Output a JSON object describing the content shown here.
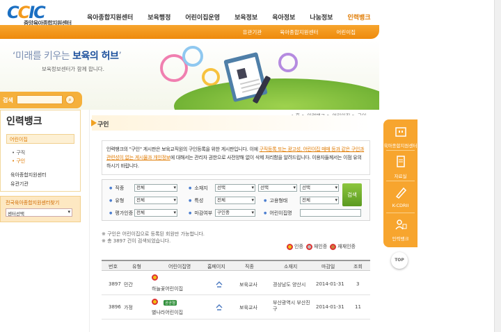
{
  "header": {
    "logo_text": "CCIC",
    "logo_name": "중앙육아종합지원센터",
    "nav": [
      "육아종합지원센터",
      "보육행정",
      "어린이집운영",
      "보육정보",
      "육아정보",
      "나눔정보",
      "인력뱅크"
    ],
    "active_nav": "인력뱅크",
    "subnav": [
      "유관기관",
      "육아종합지원센터",
      "어린이집"
    ]
  },
  "banner": {
    "slogan_pre": "‘미래를 키우는 ",
    "slogan_bold": "보육의 허브",
    "slogan_post": "’",
    "sub": "보육정보센터가 함께 합니다."
  },
  "sidebar": {
    "search_label": "검색",
    "search_value": "",
    "search_icon": "magnifier-icon",
    "title": "인력뱅크",
    "section": "어린이집",
    "sub_items": [
      "• 구직",
      "• 구인"
    ],
    "active_sub": "• 구인",
    "links": [
      "육아종합지원센터",
      "유관기관"
    ],
    "center_finder_label": "전국육아종합지원센터찾기",
    "center_select": "센터선택"
  },
  "content": {
    "breadcrumb": "⌂ 홈 > 인력뱅크 > 어린이집 > 구인",
    "title": "구인",
    "notice_1": "인력뱅크의 \"구인\" 게시판은 보육교직원의 구인등록을 위한 게시판입니다. 이에 ",
    "notice_u": "구직등록 또는 광고성, 어린이집 매매 등과 같은 구인과 관련성이 없는 게시물과 개인정보",
    "notice_2": "에 대해서는 관리자 권한으로 사전양해 없이 삭제 처리함을 알려드립니다. 이용자들께서는 이점 유의하시기 바랍니다.",
    "form": {
      "job_label": "직종",
      "job_value": "전체",
      "location_label": "소재지",
      "location_values": [
        "선택",
        "선택",
        "선택"
      ],
      "type_label": "유형",
      "type_value": "전체",
      "feature_label": "특성",
      "feature_value": "전체",
      "employ_label": "고용형태",
      "employ_value": "전체",
      "eval_label": "평가인증",
      "eval_value": "전체",
      "deadline_label": "마감여부",
      "deadline_value": "구인중",
      "name_label": "어린이집명",
      "name_value": "",
      "search_button": "검색"
    },
    "info_1": "※ 구인은 어린이집으로 등록된 회원만 가능합니다.",
    "info_2": "※ 총 3897 건이 검색되었습니다.",
    "legend": [
      "인증",
      "재인증",
      "재재인증"
    ],
    "table": {
      "headers": [
        "번호",
        "유형",
        "어린이집명",
        "홈페이지",
        "직종",
        "소재지",
        "마감일",
        "조회"
      ],
      "rows": [
        {
          "no": "3897",
          "type": "민간",
          "name": "하늘꽃어린이집",
          "badge": "",
          "job": "보육교사",
          "location": "경상남도 양산시",
          "deadline": "2014-01-31",
          "views": "3"
        },
        {
          "no": "3896",
          "type": "가정",
          "name": "별나라어린이집",
          "badge": "공공형",
          "job": "보육교사",
          "location": "부산광역시 부산진구",
          "deadline": "2014-01-31",
          "views": "11"
        }
      ]
    }
  },
  "quick": {
    "items": [
      "육아종합지원센터",
      "자료실",
      "K-CDRII",
      "인력뱅크"
    ],
    "top": "TOP"
  },
  "colors": {
    "accent": "#f7a52e",
    "active": "#e07a00",
    "search_green": "#6aaa2a"
  }
}
